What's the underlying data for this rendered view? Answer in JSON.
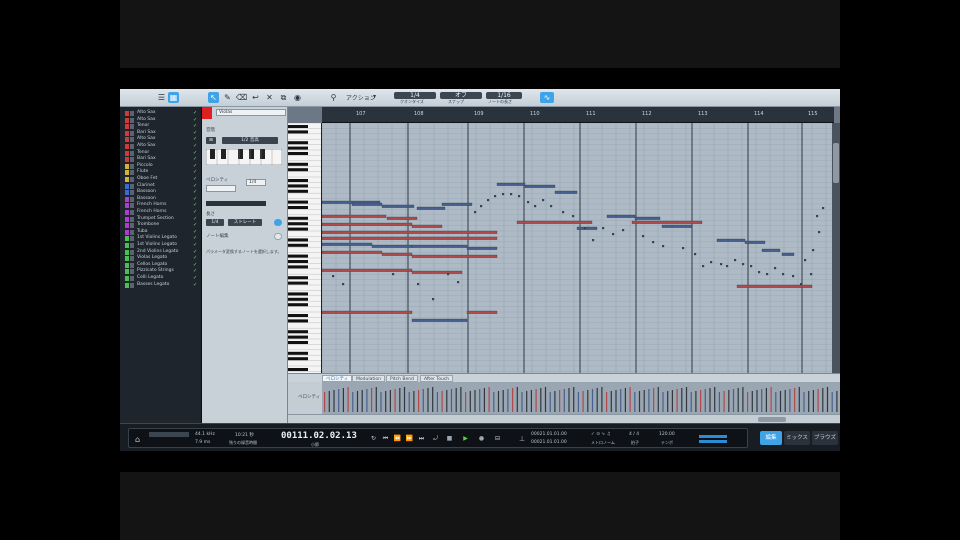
{
  "toolbar": {
    "dropdown_label": "アクション",
    "btn1": {
      "top": "1/4",
      "bottom": "クオンタイズ"
    },
    "btn2": {
      "top": "オフ",
      "bottom": "スナップ"
    },
    "btn3": {
      "top": "1/16",
      "bottom": "ノートの長さ"
    }
  },
  "tracks": [
    {
      "name": "Alto Sax",
      "color": "#d23a3a"
    },
    {
      "name": "Alto Sax",
      "color": "#d23a3a"
    },
    {
      "name": "Tenor",
      "color": "#d23a3a"
    },
    {
      "name": "Bari Sax",
      "color": "#d23a3a"
    },
    {
      "name": "Alto Sax",
      "color": "#d23a3a"
    },
    {
      "name": "Alto Sax",
      "color": "#d23a3a"
    },
    {
      "name": "Tenor",
      "color": "#d23a3a"
    },
    {
      "name": "Bari Sax",
      "color": "#d23a3a"
    },
    {
      "name": "Piccolo",
      "color": "#d2b43a"
    },
    {
      "name": "Flute",
      "color": "#d2b43a"
    },
    {
      "name": "Oboe Fet",
      "color": "#d2b43a"
    },
    {
      "name": "Clarinet",
      "color": "#3a6ad2"
    },
    {
      "name": "Bassoon",
      "color": "#3a6ad2"
    },
    {
      "name": "Bassoon",
      "color": "#b03ad2"
    },
    {
      "name": "French Horns",
      "color": "#b03ad2"
    },
    {
      "name": "French Horns",
      "color": "#b03ad2"
    },
    {
      "name": "Trumpet Section",
      "color": "#b03ad2"
    },
    {
      "name": "Trombone",
      "color": "#b03ad2"
    },
    {
      "name": "Tuba",
      "color": "#b03ad2"
    },
    {
      "name": "1st Violins Legato",
      "color": "#4ac24a"
    },
    {
      "name": "1st Violins Legato",
      "color": "#4ac24a"
    },
    {
      "name": "2nd Violins Legato",
      "color": "#4ac24a"
    },
    {
      "name": "Violas Legato",
      "color": "#4ac24a"
    },
    {
      "name": "Cellos Legato",
      "color": "#4ac24a"
    },
    {
      "name": "Pizzicato Strings",
      "color": "#4ac24a"
    },
    {
      "name": "Celli Legato",
      "color": "#4ac24a"
    },
    {
      "name": "Basses Legato",
      "color": "#4ac24a"
    }
  ],
  "inspector": {
    "channel": "Violas",
    "label_scale": "音階",
    "scale_value": "1/2 音高",
    "velocity_label": "ベロシティ",
    "velocity_btn": "1/4",
    "length_label": "長さ",
    "length_btn1": "1/4",
    "length_btn2": "ストレート",
    "arp_label": "ノート編集",
    "hint": "パラメータ変換するノートを選択します。"
  },
  "ruler": {
    "bars": [
      "107",
      "108",
      "109",
      "110",
      "111",
      "112",
      "113",
      "114",
      "115"
    ]
  },
  "lane": {
    "tabs": [
      "ベロシティ",
      "Modulation",
      "Pitch Bend",
      "After Touch"
    ],
    "label": "ベロシティ"
  },
  "transport": {
    "sample_rate": "44.1 kHz",
    "latency": "7.9 ms",
    "time": "10:21 秒",
    "time_label": "残りの録音時間",
    "position": "00111.02.02.13",
    "position_label": "小節",
    "loop_start": "00021.01.01.00",
    "loop_end": "00021.01.01.00",
    "metronome_label": "メトロノーム",
    "timesig": "4 / 4",
    "timesig_label": "拍子",
    "tempo": "120.00",
    "tempo_label": "テンポ",
    "btn_edit": "編集",
    "btn_mix": "ミックス",
    "btn_browse": "ブラウズ"
  },
  "colors": {
    "accent": "#3fa3e8",
    "note_red": "#b14a4a",
    "note_blue": "#47608f"
  }
}
